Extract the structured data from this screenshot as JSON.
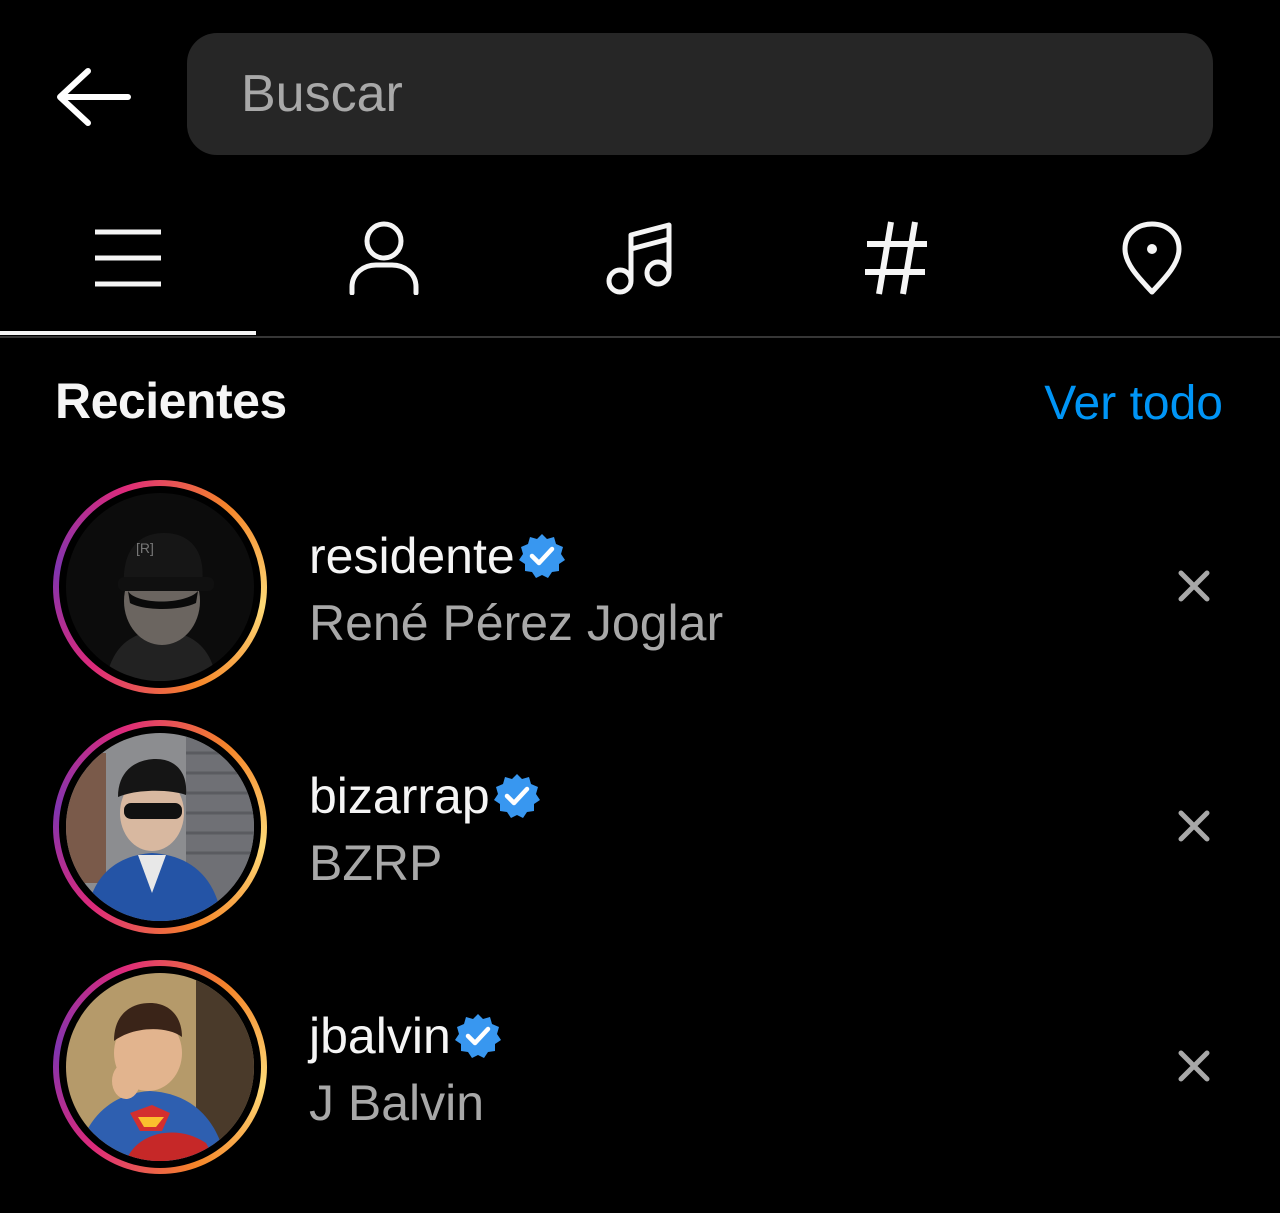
{
  "search": {
    "placeholder": "Buscar",
    "value": ""
  },
  "tabs": [
    {
      "id": "top",
      "icon": "menu-icon",
      "selected": true
    },
    {
      "id": "accounts",
      "icon": "person-icon",
      "selected": false
    },
    {
      "id": "audio",
      "icon": "music-note-icon",
      "selected": false
    },
    {
      "id": "tags",
      "icon": "hashtag-icon",
      "selected": false
    },
    {
      "id": "places",
      "icon": "location-pin-icon",
      "selected": false
    }
  ],
  "recents": {
    "title": "Recientes",
    "see_all_label": "Ver todo",
    "items": [
      {
        "username": "residente",
        "full_name": "René Pérez Joglar",
        "verified": true
      },
      {
        "username": "bizarrap",
        "full_name": "BZRP",
        "verified": true
      },
      {
        "username": "jbalvin",
        "full_name": "J Balvin",
        "verified": true
      }
    ]
  },
  "colors": {
    "background": "#000000",
    "search_bg": "#262626",
    "link_blue": "#0095f6",
    "verified_blue": "#3897f0",
    "secondary_text": "#a8a8a8"
  }
}
